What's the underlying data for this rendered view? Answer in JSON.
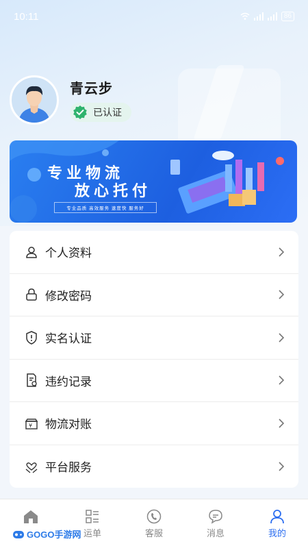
{
  "status_bar": {
    "time": "10:11",
    "battery": "86"
  },
  "profile": {
    "name": "青云步",
    "verified_label": "已认证"
  },
  "banner": {
    "line1": "专业物流",
    "line2": "放心托付",
    "tagline": "专业品质  高效服务  速度快  服务好"
  },
  "menu": [
    {
      "label": "个人资料",
      "icon": "user-icon"
    },
    {
      "label": "修改密码",
      "icon": "lock-icon"
    },
    {
      "label": "实名认证",
      "icon": "shield-icon"
    },
    {
      "label": "违约记录",
      "icon": "document-icon"
    },
    {
      "label": "物流对账",
      "icon": "ledger-icon"
    },
    {
      "label": "平台服务",
      "icon": "heart-hand-icon"
    }
  ],
  "tabs": [
    {
      "label": "",
      "icon": "home-icon"
    },
    {
      "label": "运单",
      "icon": "orders-icon"
    },
    {
      "label": "客服",
      "icon": "service-icon"
    },
    {
      "label": "消息",
      "icon": "message-icon"
    },
    {
      "label": "我的",
      "icon": "profile-icon",
      "active": true
    }
  ],
  "watermark": "GOGO手游网",
  "colors": {
    "accent": "#2d6ff0",
    "verified": "#2fb36d",
    "banner": "#1d5fe0"
  }
}
